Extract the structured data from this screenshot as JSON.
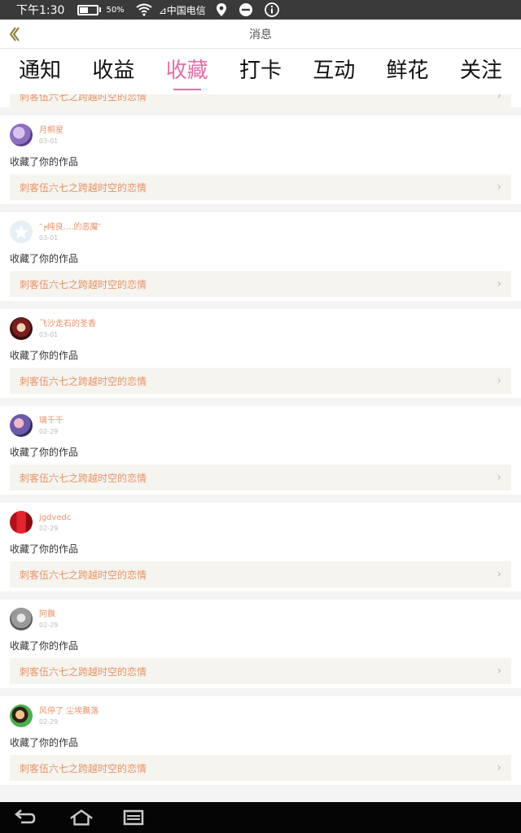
{
  "status_bar": {
    "time": "下午1:30",
    "battery_text": "50%",
    "battery_level": 0.5,
    "carrier": "⊿中国电信"
  },
  "header": {
    "title": "消息"
  },
  "tabs": [
    {
      "label": "通知",
      "active": false
    },
    {
      "label": "收益",
      "active": false
    },
    {
      "label": "收藏",
      "active": true
    },
    {
      "label": "打卡",
      "active": false
    },
    {
      "label": "互动",
      "active": false
    },
    {
      "label": "鲜花",
      "active": false
    },
    {
      "label": "关注",
      "active": false
    }
  ],
  "colors": {
    "accent": "#e26fa6",
    "username": "#e8926a",
    "link_bg": "#f5f4ee"
  },
  "partial_item": {
    "work": "刺客伍六七之跨越时空的恋情"
  },
  "items": [
    {
      "name": "月桐星",
      "date": "03-01",
      "action": "收藏了你的作品",
      "work": "刺客伍六七之跨越时空的恋情"
    },
    {
      "name": "‶┍纯良....的恶魔″",
      "date": "03-01",
      "action": "收藏了你的作品",
      "work": "刺客伍六七之跨越时空的恋情"
    },
    {
      "name": "飞沙走石的圣香",
      "date": "03-01",
      "action": "收藏了你的作品",
      "work": "刺客伍六七之跨越时空的恋情"
    },
    {
      "name": "璃千千",
      "date": "02-29",
      "action": "收藏了你的作品",
      "work": "刺客伍六七之跨越时空的恋情"
    },
    {
      "name": "jgdvedc",
      "date": "02-29",
      "action": "收藏了你的作品",
      "work": "刺客伍六七之跨越时空的恋情"
    },
    {
      "name": "阿飘",
      "date": "02-29",
      "action": "收藏了你的作品",
      "work": "刺客伍六七之跨越时空的恋情"
    },
    {
      "name": "风停了 尘埃飘落",
      "date": "02-29",
      "action": "收藏了你的作品",
      "work": "刺客伍六七之跨越时空的恋情"
    }
  ]
}
